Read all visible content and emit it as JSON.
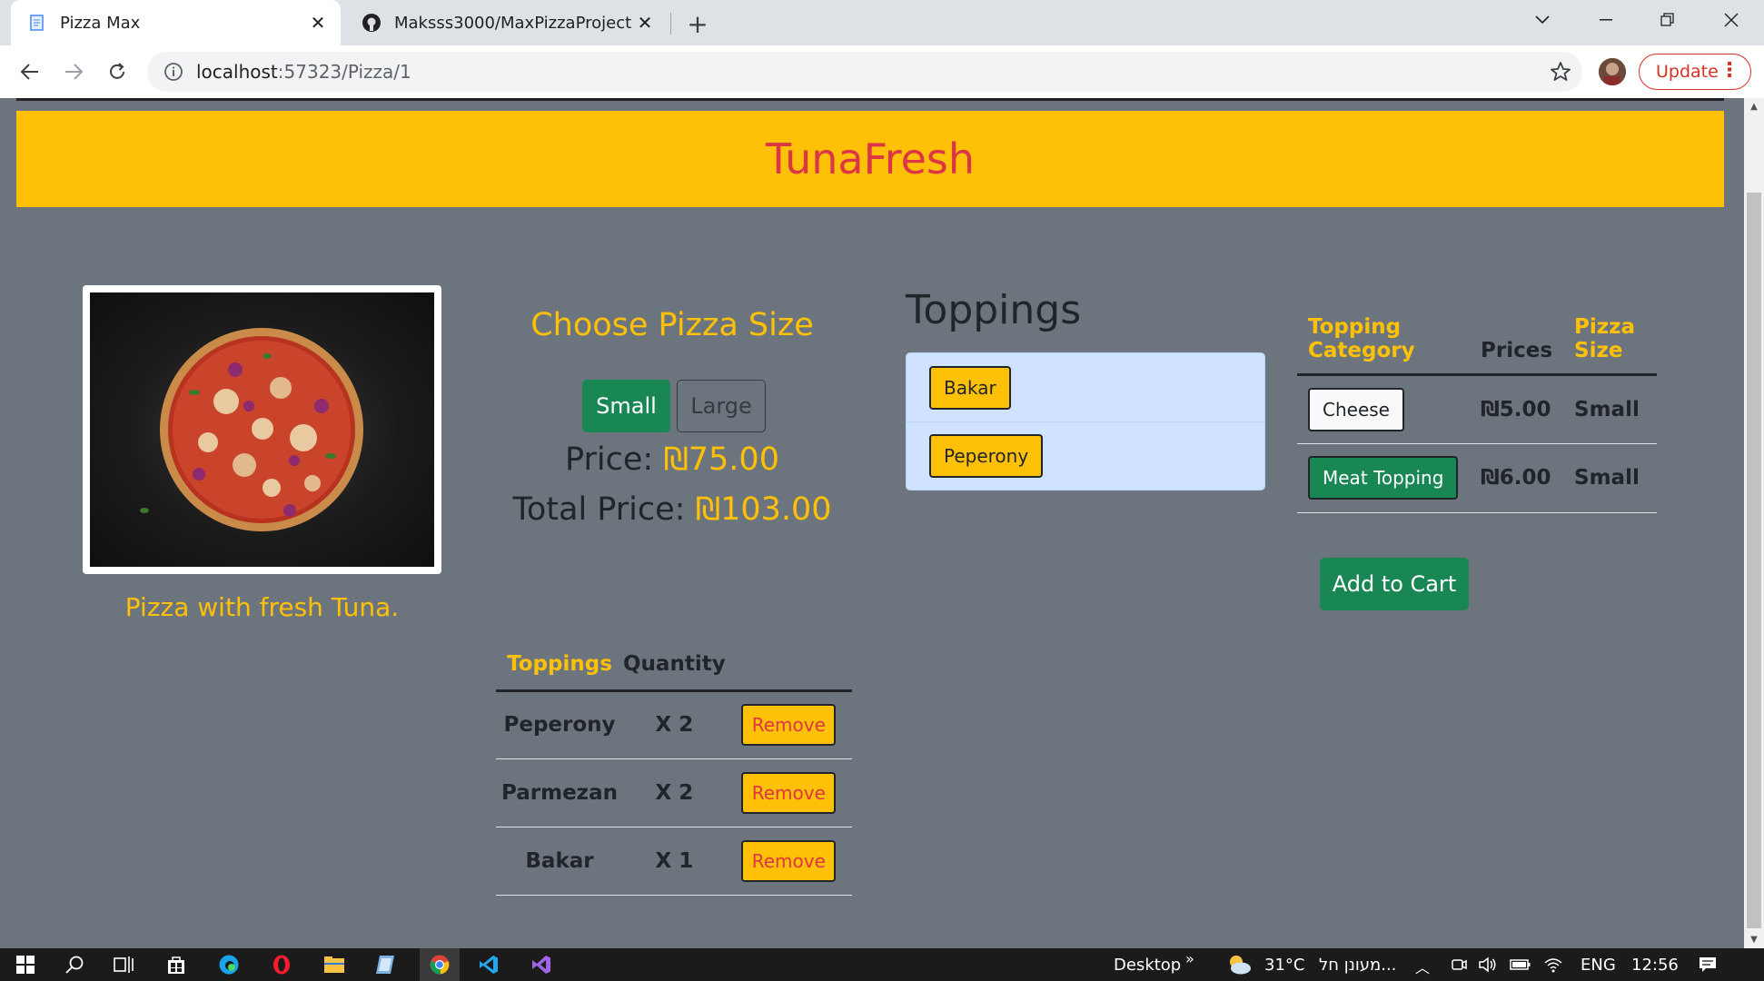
{
  "browser": {
    "tabs": [
      {
        "title": "Pizza Max",
        "active": true
      },
      {
        "title": "Maksss3000/MaxPizzaProject: My",
        "active": false
      }
    ],
    "url_host": "localhost",
    "url_path": ":57323/Pizza/1",
    "update_label": "Update"
  },
  "page": {
    "header_title": "TunaFresh",
    "pizza_description": "Pizza with fresh Tuna.",
    "size": {
      "title": "Choose Pizza Size",
      "small_label": "Small",
      "large_label": "Large",
      "selected": "Small"
    },
    "price_label": "Price:",
    "price_value": "₪75.00",
    "total_label": "Total Price:",
    "total_value": "₪103.00",
    "selected_toppings": {
      "headers": [
        "Toppings",
        "Quantity"
      ],
      "rows": [
        {
          "name": "Peperony",
          "qty": "X 2",
          "action": "Remove"
        },
        {
          "name": "Parmezan",
          "qty": "X 2",
          "action": "Remove"
        },
        {
          "name": "Bakar",
          "qty": "X 1",
          "action": "Remove"
        }
      ]
    },
    "toppings_title": "Toppings",
    "toppings_list": [
      "Bakar",
      "Peperony"
    ],
    "prices_table": {
      "headers": [
        "Topping Category",
        "Prices",
        "Pizza Size"
      ],
      "rows": [
        {
          "category": "Cheese",
          "price": "₪5.00",
          "size": "Small"
        },
        {
          "category": "Meat Topping",
          "price": "₪6.00",
          "size": "Small"
        }
      ]
    },
    "add_to_cart_label": "Add to Cart"
  },
  "taskbar": {
    "desktop_label": "Desktop",
    "temperature": "31°C",
    "weather_text": "מעונן חל...",
    "language": "ENG",
    "time": "12:56"
  },
  "colors": {
    "page_bg": "#6c757d",
    "header_bg": "#ffc107",
    "header_text": "#dc3545",
    "accent_yellow": "#ffc107",
    "success_green": "#198754",
    "list_bg": "#cfe2ff"
  }
}
